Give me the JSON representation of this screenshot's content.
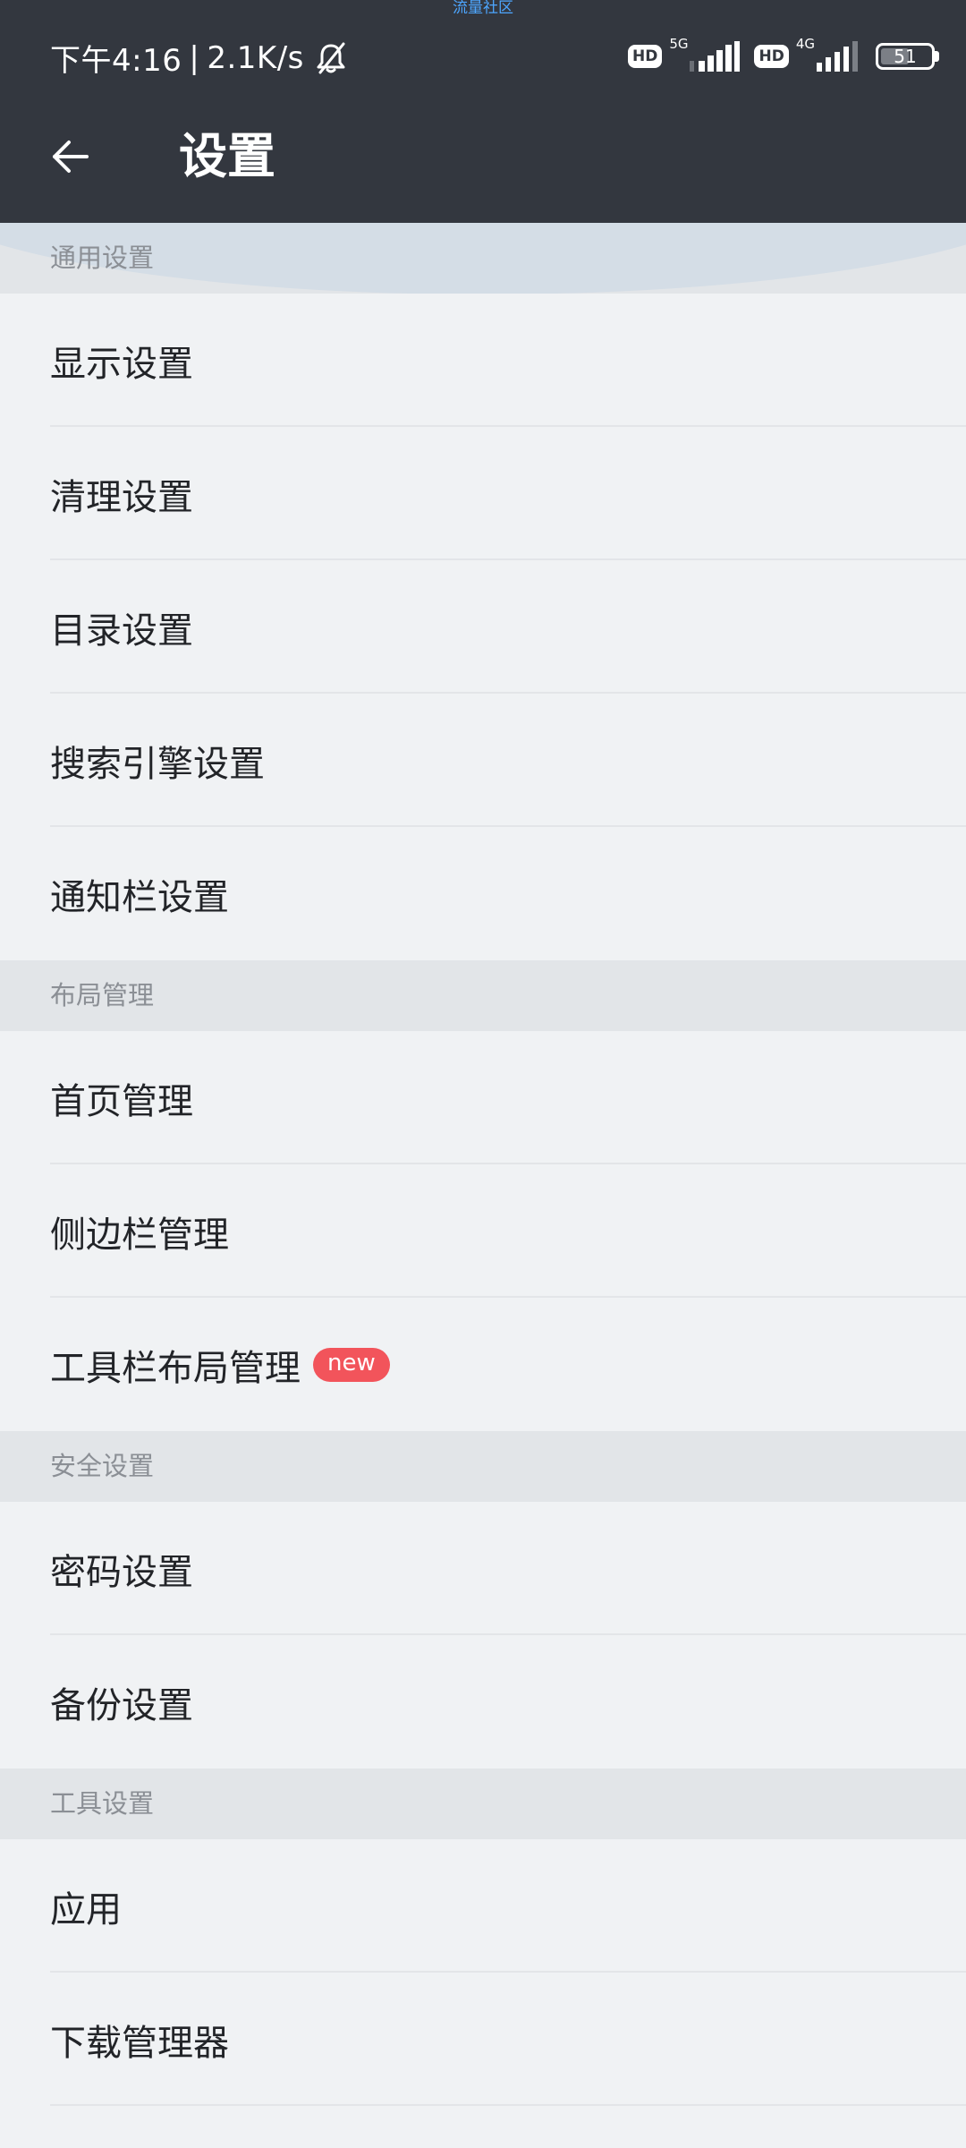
{
  "top_label": "流量社区",
  "status_bar": {
    "time": "下午4:16",
    "separator": "|",
    "network_speed": "2.1K/s",
    "sim1": {
      "hd": "HD",
      "network": "5G"
    },
    "sim2": {
      "hd": "HD",
      "network": "4G"
    },
    "battery_level": "51"
  },
  "app_bar": {
    "back_icon": "arrow-left-icon",
    "title": "设置"
  },
  "sections": [
    {
      "header": "通用设置",
      "items": [
        "显示设置",
        "清理设置",
        "目录设置",
        "搜索引擎设置",
        "通知栏设置"
      ]
    },
    {
      "header": "布局管理",
      "items": [
        "首页管理",
        "侧边栏管理",
        "工具栏布局管理"
      ],
      "badge": "new"
    },
    {
      "header": "安全设置",
      "items": [
        "密码设置",
        "备份设置"
      ]
    },
    {
      "header": "工具设置",
      "items": [
        "应用",
        "下载管理器"
      ]
    }
  ],
  "colors": {
    "header_bg": "#33373f",
    "list_bg": "#f0f2f4",
    "section_bg": "#e2e5e8",
    "badge_red": "#f2545b"
  }
}
